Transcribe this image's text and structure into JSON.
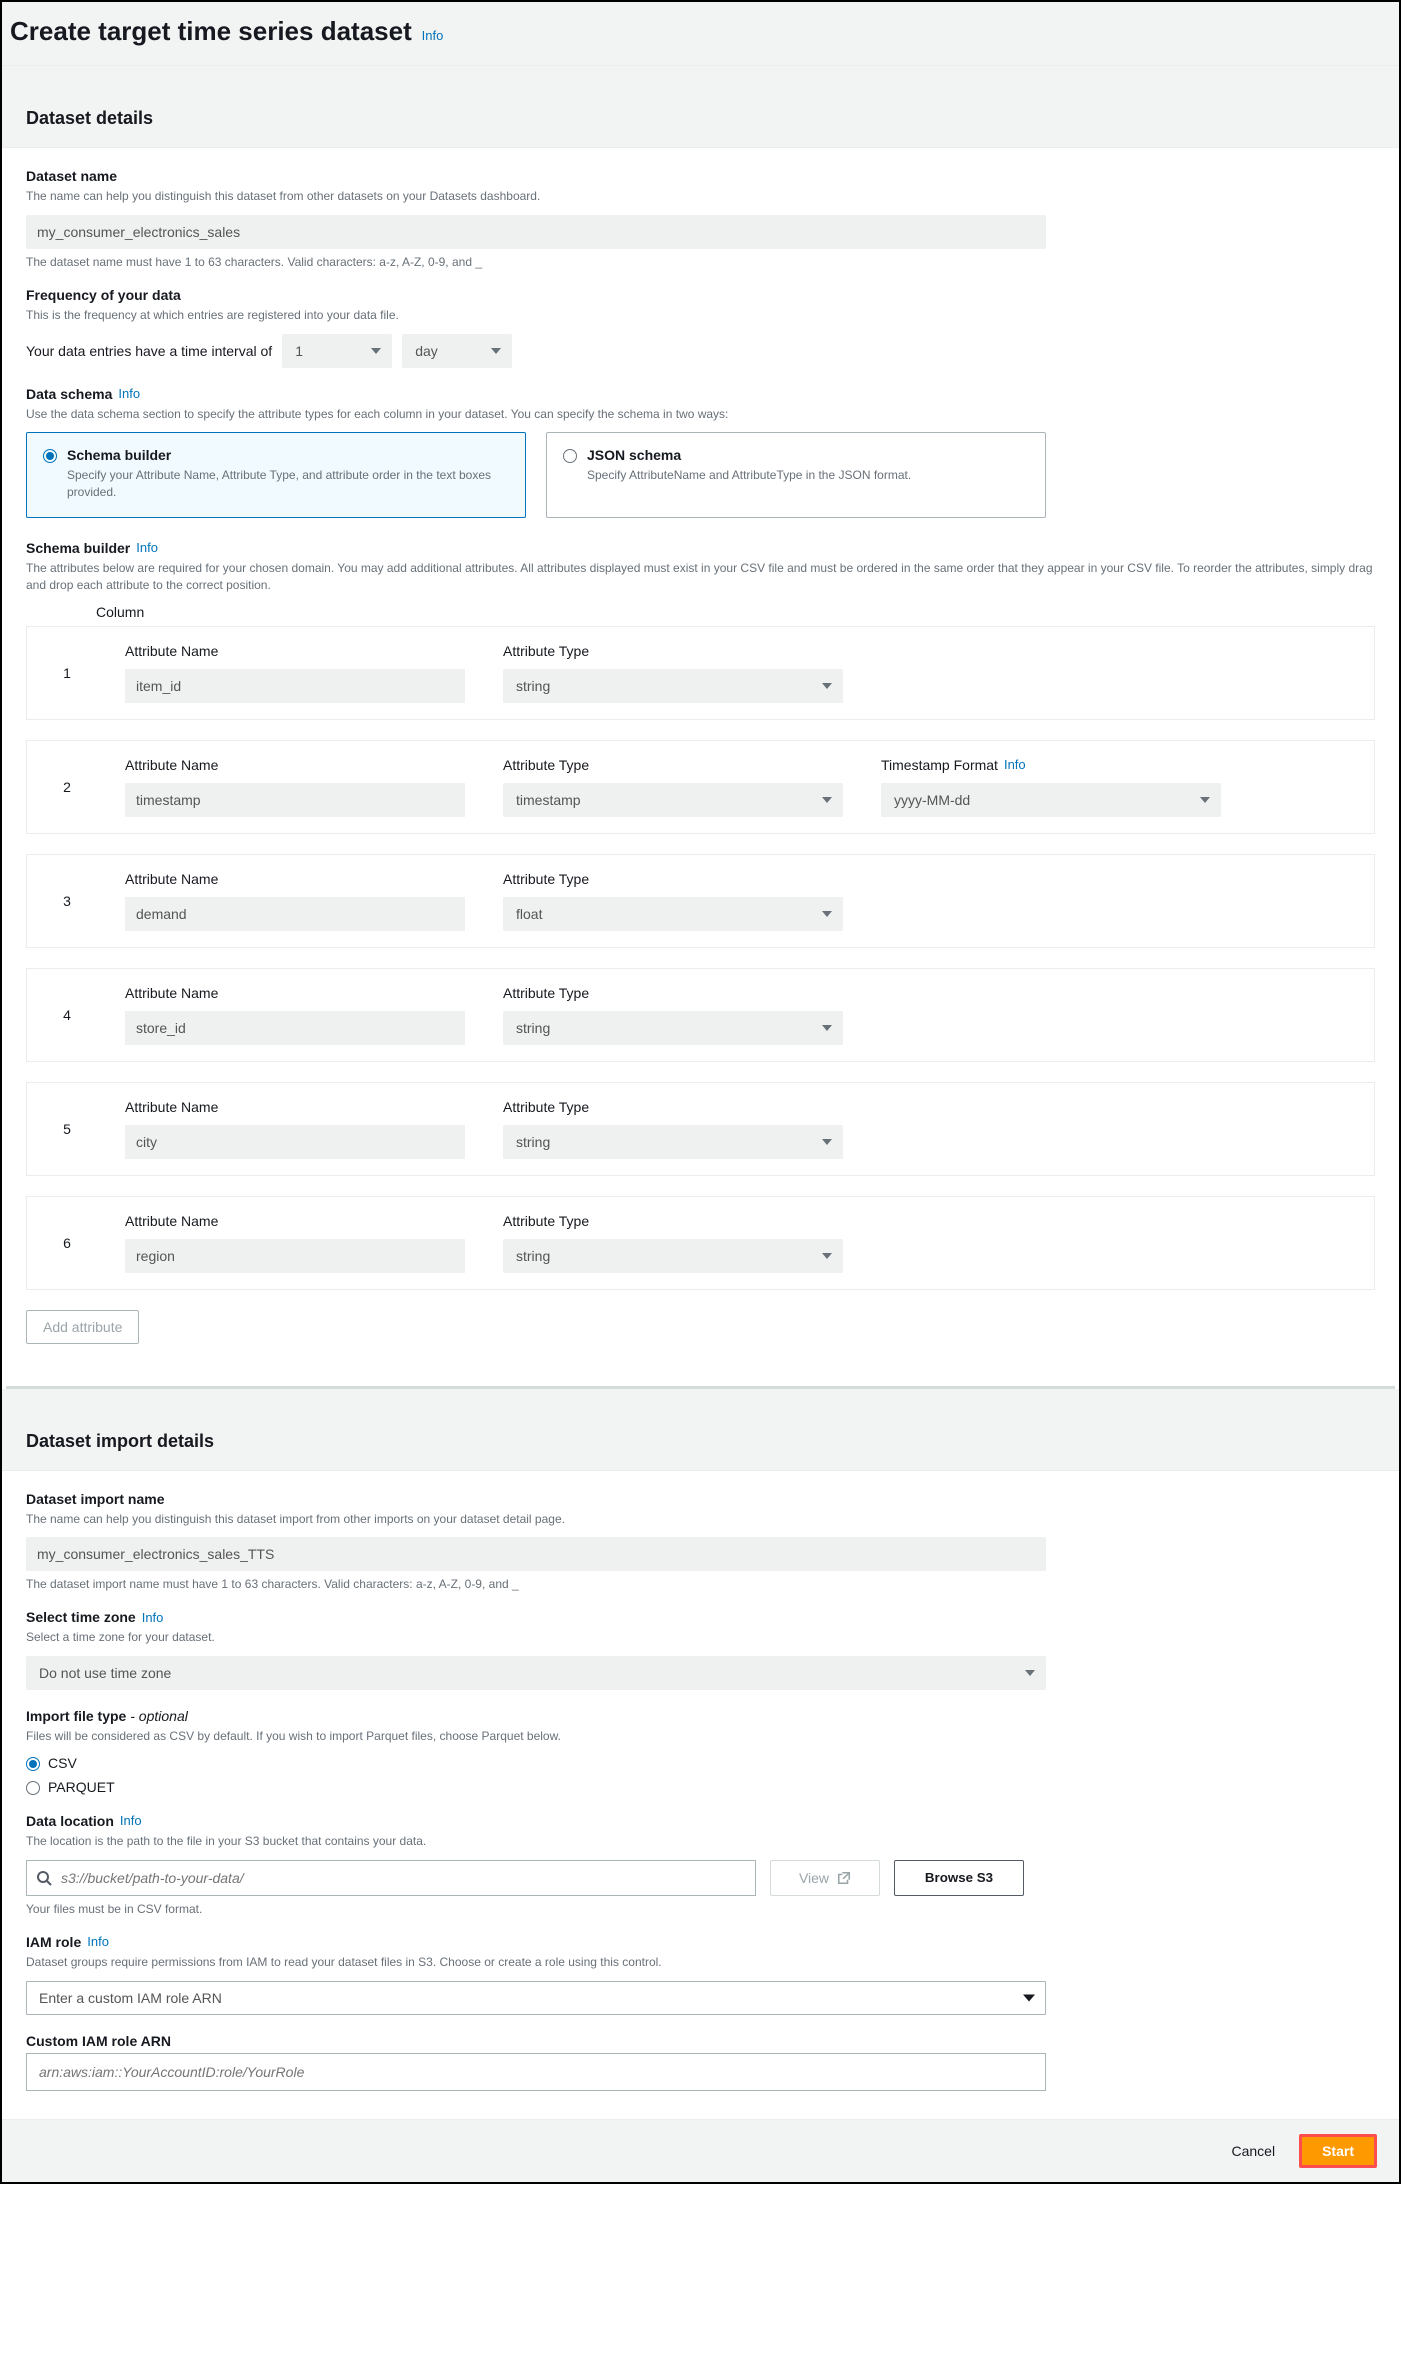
{
  "page": {
    "title": "Create target time series dataset",
    "info": "Info"
  },
  "details": {
    "heading": "Dataset details",
    "name_label": "Dataset name",
    "name_desc": "The name can help you distinguish this dataset from other datasets on your Datasets dashboard.",
    "name_value": "my_consumer_electronics_sales",
    "name_hint": "The dataset name must have 1 to 63 characters. Valid characters: a-z, A-Z, 0-9, and _",
    "freq_label": "Frequency of your data",
    "freq_desc": "This is the frequency at which entries are registered into your data file.",
    "freq_sentence": "Your data entries have a time interval of",
    "freq_num": "1",
    "freq_unit": "day",
    "schema_label": "Data schema",
    "schema_desc": "Use the data schema section to specify the attribute types for each column in your dataset. You can specify the schema in two ways:",
    "tile_builder_title": "Schema builder",
    "tile_builder_desc": "Specify your Attribute Name, Attribute Type, and attribute order in the text boxes provided.",
    "tile_json_title": "JSON schema",
    "tile_json_desc": "Specify AttributeName and AttributeType in the JSON format.",
    "builder_label": "Schema builder",
    "builder_desc": "The attributes below are required for your chosen domain. You may add additional attributes. All attributes displayed must exist in your CSV file and must be ordered in the same order that they appear in your CSV file. To reorder the attributes, simply drag and drop each attribute to the correct position.",
    "column_label": "Column",
    "attr_name_label": "Attribute Name",
    "attr_type_label": "Attribute Type",
    "ts_format_label": "Timestamp Format",
    "rows": [
      {
        "n": "1",
        "name": "item_id",
        "type": "string",
        "ts": false
      },
      {
        "n": "2",
        "name": "timestamp",
        "type": "timestamp",
        "ts": true,
        "ts_format": "yyyy-MM-dd"
      },
      {
        "n": "3",
        "name": "demand",
        "type": "float",
        "ts": false
      },
      {
        "n": "4",
        "name": "store_id",
        "type": "string",
        "ts": false
      },
      {
        "n": "5",
        "name": "city",
        "type": "string",
        "ts": false
      },
      {
        "n": "6",
        "name": "region",
        "type": "string",
        "ts": false
      }
    ],
    "add_attr": "Add attribute"
  },
  "import": {
    "heading": "Dataset import details",
    "name_label": "Dataset import name",
    "name_desc": "The name can help you distinguish this dataset import from other imports on your dataset detail page.",
    "name_value": "my_consumer_electronics_sales_TTS",
    "name_hint": "The dataset import name must have 1 to 63 characters. Valid characters: a-z, A-Z, 0-9, and _",
    "tz_label": "Select time zone",
    "tz_desc": "Select a time zone for your dataset.",
    "tz_value": "Do not use time zone",
    "filetype_label": "Import file type",
    "filetype_optional": " - optional",
    "filetype_desc": "Files will be considered as CSV by default. If you wish to import Parquet files, choose Parquet below.",
    "opt_csv": "CSV",
    "opt_parquet": "PARQUET",
    "loc_label": "Data location",
    "loc_desc": "The location is the path to the file in your S3 bucket that contains your data.",
    "loc_placeholder": "s3://bucket/path-to-your-data/",
    "loc_hint": "Your files must be in CSV format.",
    "view_btn": "View",
    "browse_btn": "Browse S3",
    "iam_label": "IAM role",
    "iam_desc": "Dataset groups require permissions from IAM to read your dataset files in S3. Choose or create a role using this control.",
    "iam_value": "Enter a custom IAM role ARN",
    "custom_arn_label": "Custom IAM role ARN",
    "custom_arn_placeholder": "arn:aws:iam::YourAccountID:role/YourRole"
  },
  "footer": {
    "cancel": "Cancel",
    "start": "Start"
  },
  "info": "Info"
}
